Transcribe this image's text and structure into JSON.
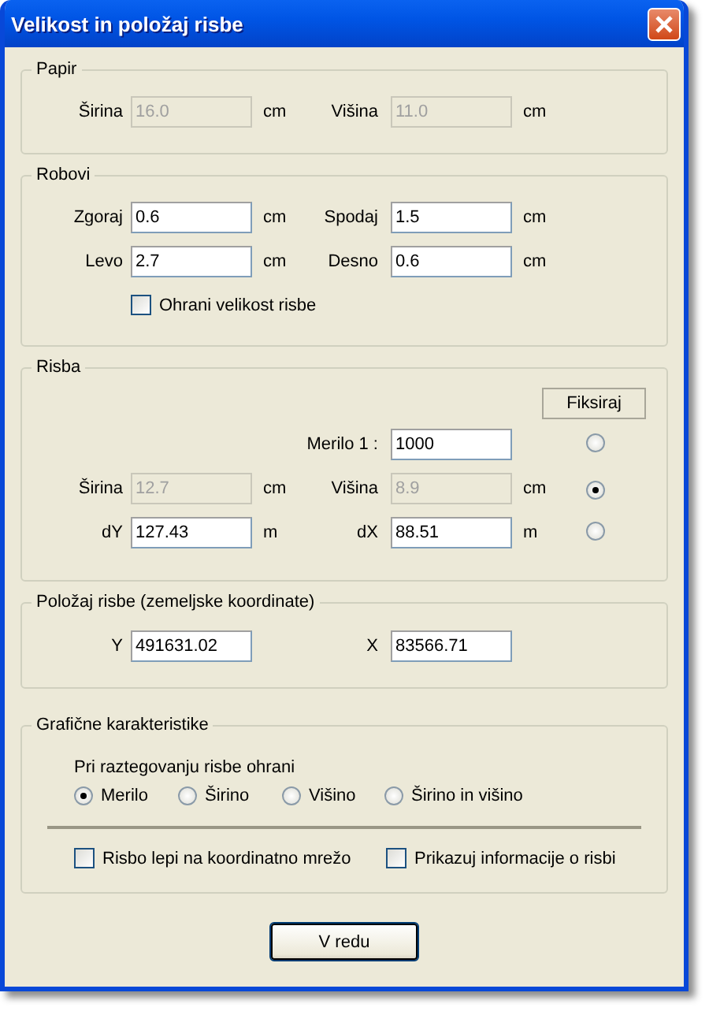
{
  "window": {
    "title": "Velikost in položaj risbe"
  },
  "paper": {
    "legend": "Papir",
    "fields": [
      {
        "label": "Širina",
        "value": "16.0",
        "unit": "cm",
        "disabled": true
      },
      {
        "label": "Višina",
        "value": "11.0",
        "unit": "cm",
        "disabled": true
      }
    ]
  },
  "margins": {
    "legend": "Robovi",
    "fields": [
      {
        "label": "Zgoraj",
        "value": "0.6",
        "unit": "cm",
        "disabled": false
      },
      {
        "label": "Spodaj",
        "value": "1.5",
        "unit": "cm",
        "disabled": false
      },
      {
        "label": "Levo",
        "value": "2.7",
        "unit": "cm",
        "disabled": false
      },
      {
        "label": "Desno",
        "value": "0.6",
        "unit": "cm",
        "disabled": false
      }
    ],
    "checkbox": {
      "label": "Ohrani velikost risbe",
      "checked": false
    }
  },
  "drawing": {
    "legend": "Risba",
    "fix_button": "Fiksiraj",
    "rows": [
      {
        "selected": false,
        "fields": [
          {
            "label": "Merilo 1 :",
            "value": "1000",
            "disabled": false
          }
        ]
      },
      {
        "selected": true,
        "fields": [
          {
            "label": "Širina",
            "value": "12.7",
            "unit": "cm",
            "disabled": true
          },
          {
            "label": "Višina",
            "value": "8.9",
            "unit": "cm",
            "disabled": true
          }
        ]
      },
      {
        "selected": false,
        "fields": [
          {
            "label": "dY",
            "value": "127.43",
            "unit": "m",
            "disabled": false
          },
          {
            "label": "dX",
            "value": "88.51",
            "unit": "m",
            "disabled": false
          }
        ]
      }
    ]
  },
  "position": {
    "legend": "Položaj risbe (zemeljske koordinate)",
    "fields": [
      {
        "label": "Y",
        "value": "491631.02",
        "disabled": false
      },
      {
        "label": "X",
        "value": "83566.71",
        "disabled": false
      }
    ]
  },
  "graphics": {
    "legend": "Grafične karakteristike",
    "caption": "Pri raztegovanju risbe ohrani",
    "options": [
      {
        "label": "Merilo",
        "selected": true
      },
      {
        "label": "Širino",
        "selected": false
      },
      {
        "label": "Višino",
        "selected": false
      },
      {
        "label": "Širino in višino",
        "selected": false
      }
    ],
    "checkboxes": [
      {
        "label": "Risbo lepi na koordinatno mrežo",
        "checked": false
      },
      {
        "label": "Prikazuj informacije o risbi",
        "checked": false
      }
    ]
  },
  "ok_button": "V redu"
}
